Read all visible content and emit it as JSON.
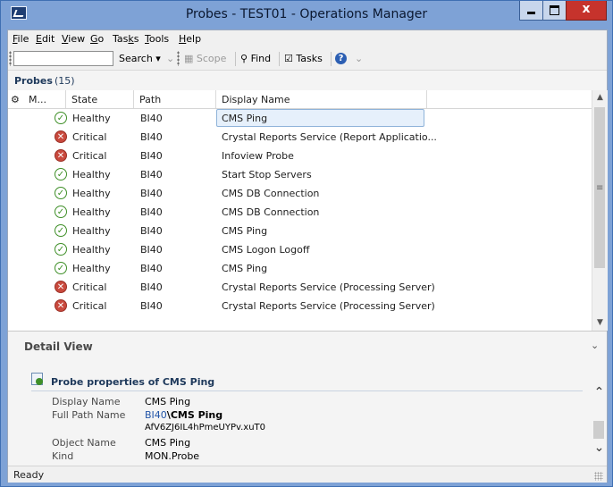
{
  "window": {
    "title": "Probes - TEST01 - Operations Manager"
  },
  "menu": [
    "File",
    "Edit",
    "View",
    "Go",
    "Tasks",
    "Tools",
    "Help"
  ],
  "toolbar": {
    "search_value": "",
    "search_label": "Search",
    "scope_label": "Scope",
    "find_label": "Find",
    "tasks_label": "Tasks"
  },
  "probes": {
    "title": "Probes",
    "count": "(15)",
    "columns": [
      "M...",
      "State",
      "Path",
      "Display Name"
    ],
    "rows": [
      {
        "state": "Healthy",
        "path": "BI40",
        "display_name": "CMS Ping",
        "selected": true
      },
      {
        "state": "Critical",
        "path": "BI40",
        "display_name": "Crystal Reports Service (Report Applicatio..."
      },
      {
        "state": "Critical",
        "path": "BI40",
        "display_name": "Infoview Probe"
      },
      {
        "state": "Healthy",
        "path": "BI40",
        "display_name": "Start Stop Servers"
      },
      {
        "state": "Healthy",
        "path": "BI40",
        "display_name": "CMS DB Connection"
      },
      {
        "state": "Healthy",
        "path": "BI40",
        "display_name": "CMS DB Connection"
      },
      {
        "state": "Healthy",
        "path": "BI40",
        "display_name": "CMS Ping"
      },
      {
        "state": "Healthy",
        "path": "BI40",
        "display_name": "CMS Logon Logoff"
      },
      {
        "state": "Healthy",
        "path": "BI40",
        "display_name": "CMS Ping"
      },
      {
        "state": "Critical",
        "path": "BI40",
        "display_name": "Crystal Reports Service (Processing Server)"
      },
      {
        "state": "Critical",
        "path": "BI40",
        "display_name": "Crystal Reports Service (Processing Server)"
      }
    ]
  },
  "detail": {
    "title": "Detail View",
    "props_title": "Probe properties of CMS Ping",
    "display_name_label": "Display Name",
    "display_name_value": "CMS Ping",
    "full_path_label": "Full Path Name",
    "full_path_link": "BI40",
    "full_path_sep": "\\",
    "full_path_bold": "CMS Ping",
    "full_path_id": "AfV6ZJ6IL4hPmeUYPv.xuT0",
    "object_name_label": "Object Name",
    "object_name_value": "CMS Ping",
    "kind_label": "Kind",
    "kind_value": "MON.Probe"
  },
  "status": {
    "text": "Ready"
  },
  "colors": {
    "titlebar": "#7ea2d6",
    "healthy": "#3f8f28",
    "critical": "#c94a3e",
    "selection": "#e6f0fb"
  }
}
